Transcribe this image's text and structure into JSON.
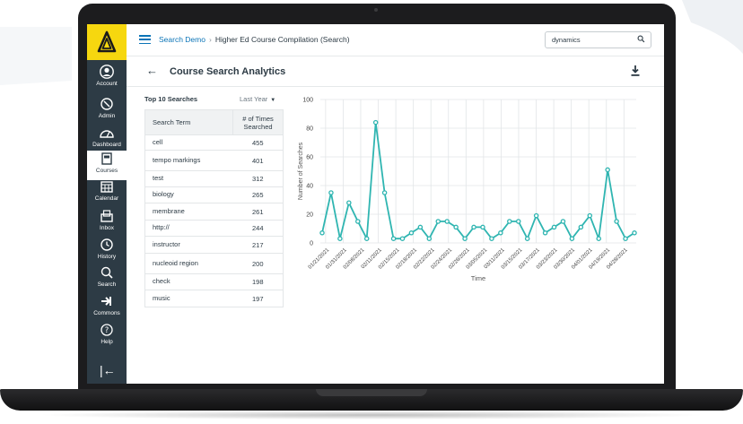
{
  "breadcrumb": {
    "root": "Search Demo",
    "separator": "›",
    "current": "Higher Ed Course Compilation (Search)"
  },
  "search": {
    "value": "dynamics",
    "icon": "search-icon"
  },
  "page": {
    "title": "Course Search Analytics",
    "back_icon": "arrow-left-icon",
    "download_icon": "download-icon"
  },
  "sidebar": {
    "items": [
      {
        "label": "Account",
        "icon": "account-icon"
      },
      {
        "label": "Admin",
        "icon": "admin-icon"
      },
      {
        "label": "Dashboard",
        "icon": "dashboard-icon"
      },
      {
        "label": "Courses",
        "icon": "courses-icon",
        "active": true
      },
      {
        "label": "Calendar",
        "icon": "calendar-icon"
      },
      {
        "label": "Inbox",
        "icon": "inbox-icon"
      },
      {
        "label": "History",
        "icon": "history-icon"
      },
      {
        "label": "Search",
        "icon": "search-icon"
      },
      {
        "label": "Commons",
        "icon": "commons-icon"
      },
      {
        "label": "Help",
        "icon": "help-icon"
      }
    ],
    "collapse_icon": "collapse-icon"
  },
  "top_searches": {
    "title": "Top 10 Searches",
    "period": "Last Year",
    "columns": [
      "Search Term",
      "# of Times Searched"
    ],
    "rows": [
      {
        "term": "cell",
        "count": "455"
      },
      {
        "term": "tempo markings",
        "count": "401"
      },
      {
        "term": "test",
        "count": "312"
      },
      {
        "term": "biology",
        "count": "265"
      },
      {
        "term": "membrane",
        "count": "261"
      },
      {
        "term": "http://",
        "count": "244"
      },
      {
        "term": "instructor",
        "count": "217"
      },
      {
        "term": "nucleoid region",
        "count": "200"
      },
      {
        "term": "check",
        "count": "198"
      },
      {
        "term": "music",
        "count": "197"
      }
    ]
  },
  "colors": {
    "accent": "#0b74b7",
    "sidebar": "#2d3b45",
    "logo": "#f6d70f",
    "series": "#2fb5b1"
  },
  "chart_data": {
    "type": "line",
    "xlabel": "Time",
    "ylabel": "Number of Searches",
    "ylim": [
      0,
      100
    ],
    "yticks": [
      0,
      20,
      40,
      60,
      80,
      100
    ],
    "grid": true,
    "xticks": [
      "01/21/2021",
      "01/31/2021",
      "02/08/2021",
      "02/11/2021",
      "02/15/2021",
      "02/18/2021",
      "02/22/2021",
      "02/24/2021",
      "02/26/2021",
      "03/05/2021",
      "03/11/2021",
      "03/15/2021",
      "03/17/2021",
      "03/23/2021",
      "03/30/2021",
      "04/01/2021",
      "04/19/2021",
      "04/28/2021"
    ],
    "values": [
      7,
      35,
      3,
      28,
      15,
      3,
      84,
      35,
      3,
      3,
      7,
      11,
      3,
      15,
      15,
      11,
      3,
      11,
      11,
      3,
      7,
      15,
      15,
      3,
      19,
      7,
      11,
      15,
      3,
      11,
      19,
      3,
      51,
      15,
      3,
      7
    ]
  }
}
